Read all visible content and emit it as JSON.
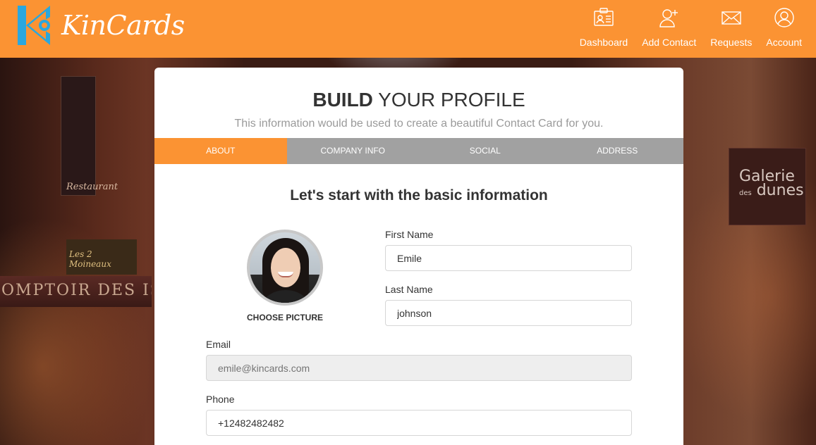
{
  "app": {
    "name": "KinCards",
    "logo_letter": "K"
  },
  "nav": [
    {
      "label": "Dashboard",
      "icon": "id-card-icon"
    },
    {
      "label": "Add Contact",
      "icon": "add-user-icon"
    },
    {
      "label": "Requests",
      "icon": "envelope-icon"
    },
    {
      "label": "Account",
      "icon": "user-circle-icon"
    }
  ],
  "background": {
    "restaurant_sign": "Restaurant",
    "awning_text": "OMPTOIR DES ISLES",
    "shop_sign": "Les 2 Moineaux",
    "gallery_line1": "Galerie",
    "gallery_small": "des",
    "gallery_line2": "dunes"
  },
  "profile": {
    "title_bold": "BUILD",
    "title_rest": " YOUR PROFILE",
    "subtitle": "This information would be used to create a beautiful Contact Card for you.",
    "tabs": [
      {
        "label": "ABOUT",
        "active": true
      },
      {
        "label": "COMPANY INFO",
        "active": false
      },
      {
        "label": "SOCIAL",
        "active": false
      },
      {
        "label": "ADDRESS",
        "active": false
      }
    ],
    "section_heading": "Let's start with the basic information",
    "choose_picture": "CHOOSE PICTURE",
    "fields": {
      "first_name": {
        "label": "First Name",
        "value": "Emile"
      },
      "last_name": {
        "label": "Last Name",
        "value": "johnson"
      },
      "email": {
        "label": "Email",
        "value": "",
        "placeholder": "emile@kincards.com"
      },
      "phone": {
        "label": "Phone",
        "value": "+12482482482"
      }
    }
  },
  "colors": {
    "brand_orange": "#fb9333",
    "tab_gray": "#a1a1a1",
    "logo_blue": "#2aa7de"
  }
}
